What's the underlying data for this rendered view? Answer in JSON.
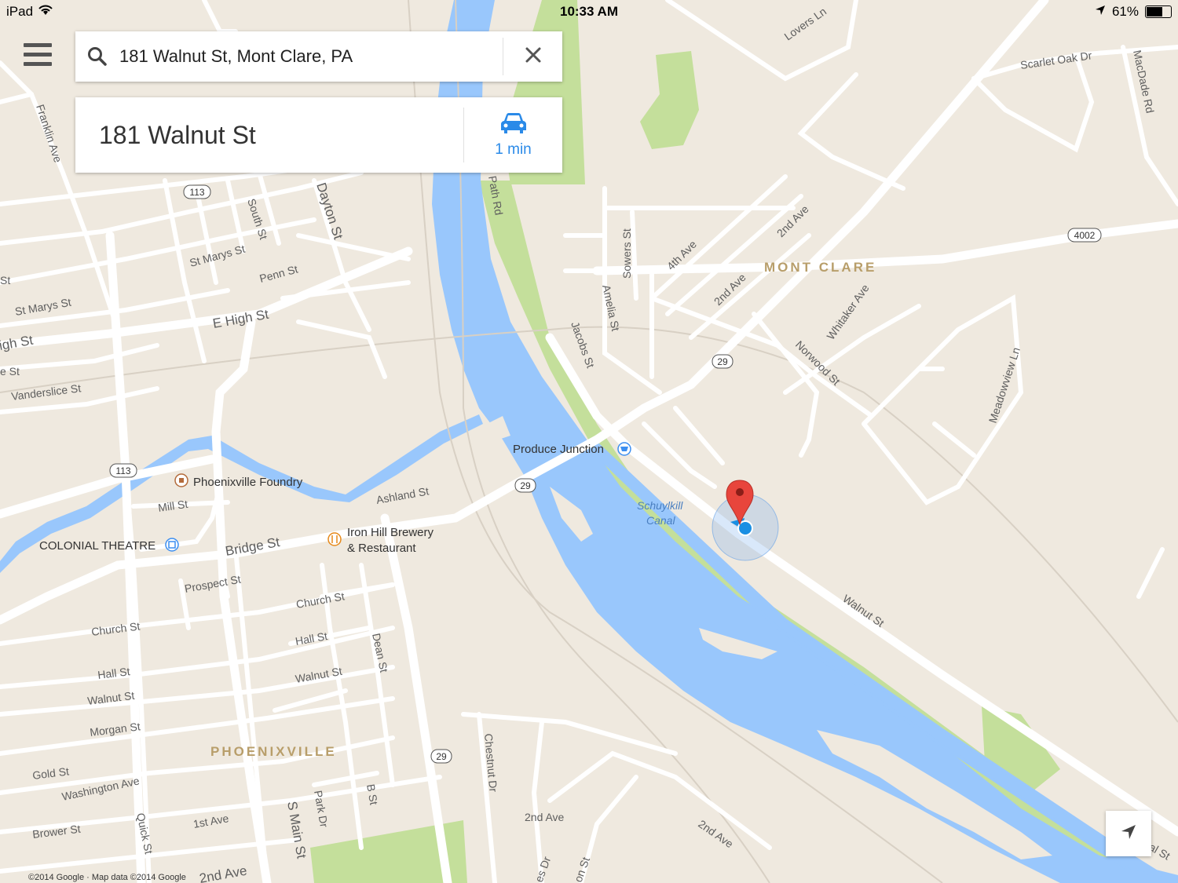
{
  "status_bar": {
    "device": "iPad",
    "time": "10:33 AM",
    "battery_percent": "61%",
    "battery_level": 0.61
  },
  "search": {
    "query": "181 Walnut St, Mont Clare, PA"
  },
  "result_card": {
    "title": "181 Walnut St",
    "drive_time": "1 min"
  },
  "map": {
    "areas": {
      "mont_clare": "MONT CLARE",
      "phoenixville": "PHOENIXVILLE"
    },
    "pois": {
      "produce_junction": "Produce Junction",
      "phoenixville_foundry": "Phoenixville Foundry",
      "colonial_theatre": "COLONIAL THEATRE",
      "iron_hill_1": "Iron Hill Brewery",
      "iron_hill_2": "& Restaurant"
    },
    "water": {
      "canal_1": "Schuylkill",
      "canal_2": "Canal"
    },
    "route_shields": {
      "r113": "113",
      "r29": "29",
      "r4002": "4002"
    },
    "streets": {
      "franklin_ave": "Franklin Ave",
      "dayton_st": "Dayton St",
      "south_st": "South St",
      "st_marys_st": "St Marys St",
      "penn_st": "Penn St",
      "e_high_st": "E High St",
      "high_st": "igh St",
      "vanderslice_st": "Vanderslice St",
      "st_fragment_1": "St",
      "st_fragment_2": "e St",
      "path_rd": "Path Rd",
      "mill_st": "Mill St",
      "ashland_st": "Ashland St",
      "bridge_st": "Bridge St",
      "prospect_st": "Prospect St",
      "church_st": "Church St",
      "hall_st": "Hall St",
      "walnut_st": "Walnut St",
      "morgan_st": "Morgan St",
      "dean_st": "Dean St",
      "gold_st": "Gold St",
      "washington_ave": "Washington Ave",
      "brower_st": "Brower St",
      "quick_st": "Quick St",
      "first_ave": "1st Ave",
      "s_main_st": "S Main St",
      "park_dr": "Park Dr",
      "b_st": "B St",
      "chestnut_dr": "Chestnut Dr",
      "second_ave": "2nd Ave",
      "second_ave_fragment": "2nd Ave",
      "sowers_st": "Sowers St",
      "amelia_st": "Amelia St",
      "jacobs_st": "Jacobs St",
      "fourth_ave": "4th Ave",
      "norwood_st": "Norwood St",
      "whitaker_ave": "Whitaker Ave",
      "meadowview_ln": "Meadowview Ln",
      "lovers_ln": "Lovers Ln",
      "scarlet_oak_dr": "Scarlet Oak Dr",
      "macdade_rd": "MacDade Rd",
      "canal_st": "al St",
      "es_dr": "es Dr",
      "on_st": "on St"
    }
  },
  "copyright": "©2014 Google · Map data ©2014 Google"
}
